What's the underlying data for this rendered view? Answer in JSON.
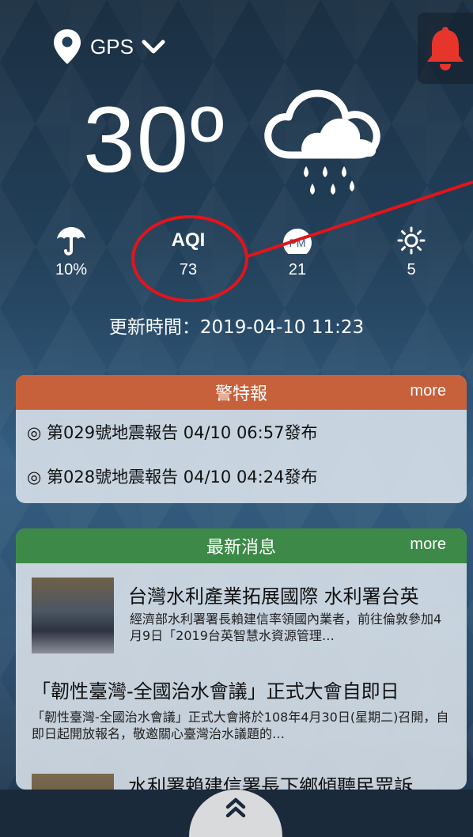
{
  "location": {
    "label": "GPS"
  },
  "weather": {
    "temperature": "30º",
    "stats": [
      {
        "name": "rain",
        "icon": "umbrella-icon",
        "value": "10%"
      },
      {
        "name": "aqi",
        "label": "AQI",
        "value": "73"
      },
      {
        "name": "pm",
        "icon": "pm-icon",
        "icon_text": "PM",
        "value": "21"
      },
      {
        "name": "uv",
        "icon": "sun-icon",
        "value": "5"
      }
    ],
    "update_time": "更新時間：2019-04-10 11:23"
  },
  "alerts": {
    "title": "警特報",
    "more": "more",
    "items": [
      "◎ 第029號地震報告 04/10 06:57發布",
      "◎ 第028號地震報告 04/10 04:24發布"
    ]
  },
  "news": {
    "title": "最新消息",
    "more": "more",
    "items": [
      {
        "title": "台灣水利產業拓展國際  水利署台英",
        "desc": "經濟部水利署署長賴建信率領國內業者，前往倫敦參加4月9日「2019台英智慧水資源管理…"
      },
      {
        "title": "「韌性臺灣-全國治水會議」正式大會自即日",
        "desc": "「韌性臺灣-全國治水會議」正式大會將於108年4月30日(星期二)召開，自即日起開放報名，敬邀關心臺灣治水議題的…"
      },
      {
        "title": "水利署賴建信署長下鄉傾聽民眾訴"
      }
    ]
  },
  "colors": {
    "alert_header": "#c7613b",
    "news_header": "#3d8a48",
    "bell": "#e8352b",
    "highlight": "#e3141b"
  }
}
